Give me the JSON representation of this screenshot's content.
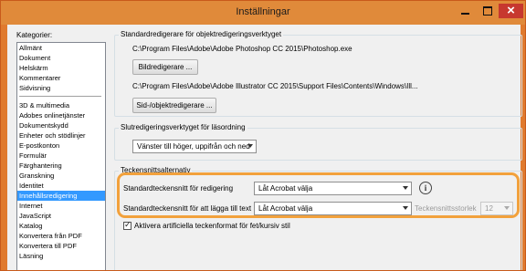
{
  "window": {
    "title": "Inställningar"
  },
  "categories": {
    "label": "Kategorier:",
    "group1": [
      "Allmänt",
      "Dokument",
      "Helskärm",
      "Kommentarer",
      "Sidvisning"
    ],
    "group2": [
      "3D & multimedia",
      "Adobes onlinetjänster",
      "Dokumentskydd",
      "Enheter och stödlinjer",
      "E-postkonton",
      "Formulär",
      "Färghantering",
      "Granskning",
      "Identitet",
      "Innehållsredigering",
      "Internet",
      "JavaScript",
      "Katalog",
      "Konvertera från PDF",
      "Konvertera till PDF",
      "Läsning"
    ],
    "selected": "Innehållsredigering"
  },
  "object_editors": {
    "group_title": "Standardredigerare för objektredigeringsverktyget",
    "image_path": "C:\\Program Files\\Adobe\\Adobe Photoshop CC 2015\\Photoshop.exe",
    "image_button": "Bildredigerare ...",
    "page_path": "C:\\Program Files\\Adobe\\Adobe Illustrator CC 2015\\Support Files\\Contents\\Windows\\Ill...",
    "page_button": "Sid-/objektredigerare ..."
  },
  "reading_order": {
    "group_title": "Slutredigeringsverktyget för läsordning",
    "value": "Vänster till höger, uppifrån och ned"
  },
  "font_options": {
    "group_title": "Teckensnittsalternativ",
    "edit_font_label": "Standardteckensnitt för redigering",
    "edit_font_value": "Låt Acrobat välja",
    "add_font_label": "Standardteckensnitt för att lägga till text",
    "add_font_value": "Låt Acrobat välja",
    "font_size_label": "Teckensnittsstorlek",
    "font_size_value": "12",
    "artificial_label": "Aktivera artificiella teckenformat för fet/kursiv stil",
    "artificial_checked": true,
    "info_glyph": "i"
  },
  "colors": {
    "titlebar": "#e08a3a",
    "selection": "#3399ff",
    "highlight": "#f2a13c",
    "close": "#c7382f"
  }
}
